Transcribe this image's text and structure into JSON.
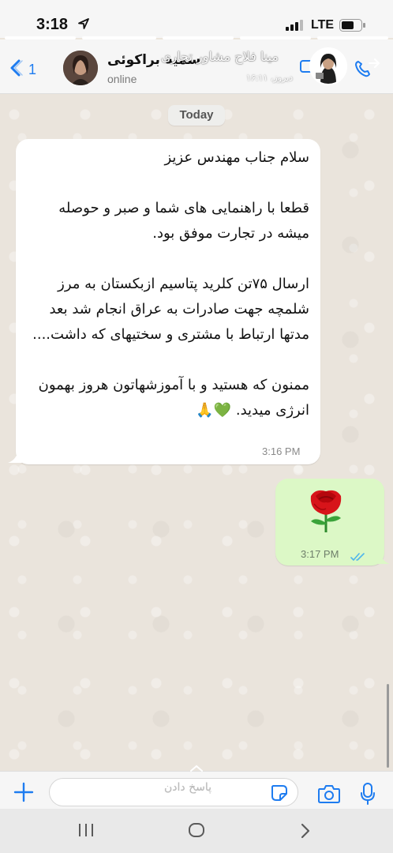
{
  "status_bar": {
    "time": "3:18",
    "network": "LTE"
  },
  "header": {
    "back_count": "1",
    "contact_name": "سمیه براکوئی",
    "contact_status": "online",
    "overlay_name": "مینا فلاح مشاور تجاری",
    "overlay_time": "دیروز، ۱۶:۱۱"
  },
  "chat": {
    "date_label": "Today",
    "messages": [
      {
        "direction": "incoming",
        "text": "سلام جناب مهندس عزیز\n\nقطعا با راهنمایی های شما و صبر و حوصله میشه در تجارت موفق بود.\n\nارسال ۷۵تن کلرید پتاسیم ازبکستان به مرز شلمچه جهت صادرات به عراق انجام شد بعد مدتها ارتباط با مشتری و سختیهای که داشت....\n\nممنون که هستید و با آموزشهاتون هروز بهمون انرژی میدید. 💚🙏",
        "time": "3:16 PM"
      },
      {
        "direction": "outgoing",
        "content_icon": "rose-icon",
        "time": "3:17 PM",
        "status": "read"
      }
    ]
  },
  "composer": {
    "placeholder": "پاسخ دادن"
  },
  "icons": {
    "back": "chevron-left-icon",
    "call": "phone-icon",
    "add": "plus-icon",
    "sticker": "sticker-icon",
    "camera": "camera-icon",
    "mic": "microphone-icon"
  },
  "colors": {
    "accent": "#1e7cf0",
    "outgoing_bubble": "#dcf8c6",
    "incoming_bubble": "#ffffff",
    "read_ticks": "#4fb6ec"
  }
}
